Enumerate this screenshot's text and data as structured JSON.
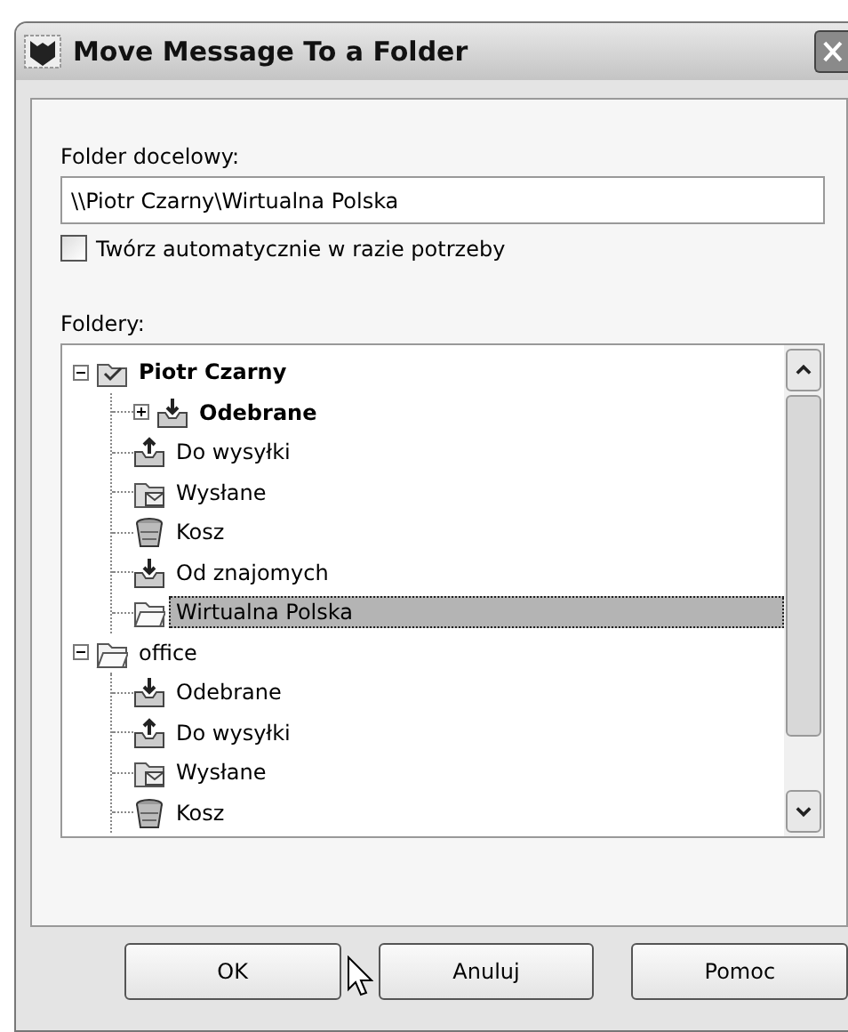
{
  "window": {
    "title": "Move Message To a Folder"
  },
  "destination": {
    "label": "Folder docelowy:",
    "value": "\\\\Piotr Czarny\\Wirtualna Polska"
  },
  "auto_create": {
    "label": "Twórz automatycznie w razie potrzeby",
    "checked": false
  },
  "folders": {
    "label": "Foldery:",
    "tree": [
      {
        "label": "Piotr Czarny",
        "kind": "account",
        "unread": true,
        "expanded": true,
        "selected": false,
        "children": [
          {
            "label": "Odebrane",
            "kind": "inbox",
            "unread": true,
            "expanded": false,
            "selected": false
          },
          {
            "label": "Do wysyłki",
            "kind": "outbox",
            "unread": false,
            "selected": false
          },
          {
            "label": "Wysłane",
            "kind": "sent",
            "unread": false,
            "selected": false
          },
          {
            "label": "Kosz",
            "kind": "trash",
            "unread": false,
            "selected": false
          },
          {
            "label": "Od znajomych",
            "kind": "inbox",
            "unread": false,
            "selected": false
          },
          {
            "label": "Wirtualna Polska",
            "kind": "folder",
            "unread": false,
            "selected": true
          }
        ]
      },
      {
        "label": "office",
        "kind": "folder",
        "unread": false,
        "expanded": true,
        "selected": false,
        "children": [
          {
            "label": "Odebrane",
            "kind": "inbox",
            "unread": false,
            "selected": false
          },
          {
            "label": "Do wysyłki",
            "kind": "outbox",
            "unread": false,
            "selected": false
          },
          {
            "label": "Wysłane",
            "kind": "sent",
            "unread": false,
            "selected": false
          },
          {
            "label": "Kosz",
            "kind": "trash",
            "unread": false,
            "selected": false
          }
        ]
      }
    ]
  },
  "buttons": [
    {
      "label": "OK"
    },
    {
      "label": "Anuluj"
    },
    {
      "label": "Pomoc"
    }
  ]
}
